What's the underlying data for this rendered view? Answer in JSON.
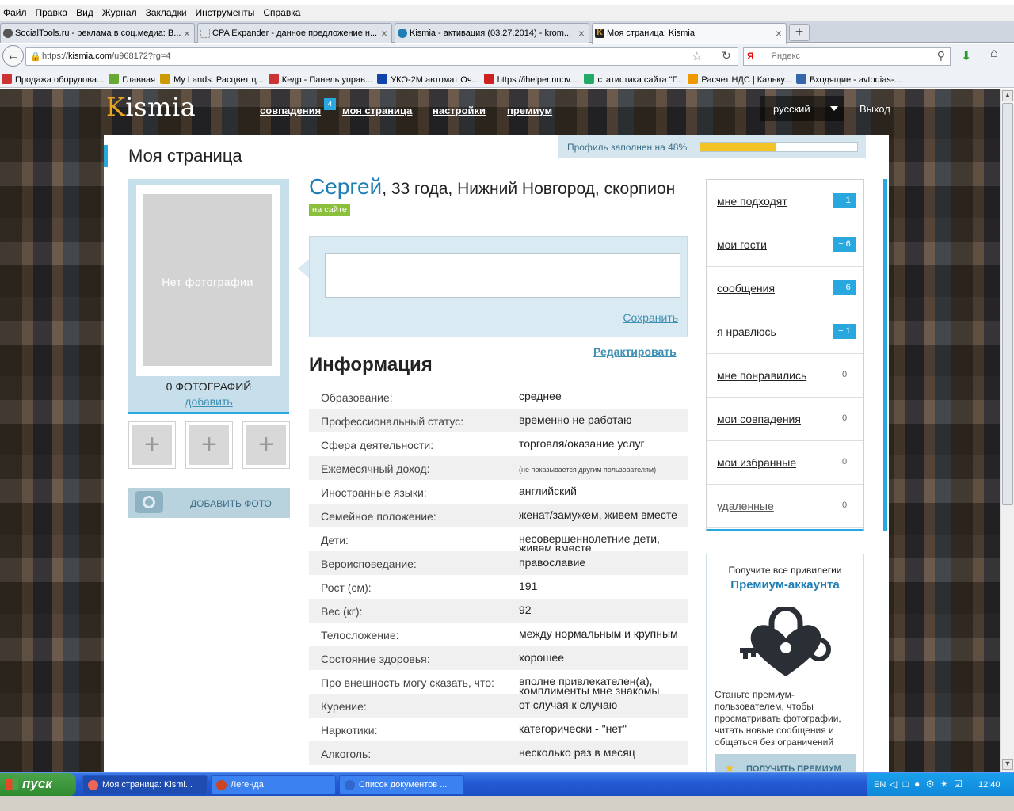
{
  "menu": [
    "Файл",
    "Правка",
    "Вид",
    "Журнал",
    "Закладки",
    "Инструменты",
    "Справка"
  ],
  "tabs": [
    {
      "label": "SocialTools.ru - реклама в соц.медиа: В...",
      "color": "#555"
    },
    {
      "label": "CPA Expander - данное предложение н...",
      "color": "#999"
    },
    {
      "label": "Kismia - активация (03.27.2014) - krom...",
      "color": "#1f7fb5"
    },
    {
      "label": "Моя страница: Kismia",
      "color": "#222"
    }
  ],
  "address": {
    "prefix": "https://",
    "host": "kismia.com",
    "path": "/u968172?rg=4"
  },
  "search": {
    "placeholder": "Яндекс"
  },
  "bookmarks": [
    {
      "label": "Продажа оборудова...",
      "color": "#c33"
    },
    {
      "label": "Главная",
      "color": "#6a3"
    },
    {
      "label": "My Lands: Расцвет ц...",
      "color": "#c90"
    },
    {
      "label": "Кедр - Панель управ...",
      "color": "#c33"
    },
    {
      "label": "УКО-2М автомат Оч...",
      "color": "#14a"
    },
    {
      "label": "https://ihelper.nnov....",
      "color": "#c22"
    },
    {
      "label": "статистика сайта \"Г...",
      "color": "#2a6"
    },
    {
      "label": "Расчет НДС | Кальку...",
      "color": "#e90"
    },
    {
      "label": "Входящие - avtodias-...",
      "color": "#36a"
    }
  ],
  "site": {
    "logo_k": "K",
    "logo_rest": "ismia",
    "nav": {
      "matches": "совпадения",
      "matches_badge": "4",
      "mypage": "моя страница",
      "settings": "настройки",
      "premium": "премиум"
    },
    "lang": "русский",
    "logout": "Выход"
  },
  "page": {
    "title": "Моя страница",
    "progress_label": "Профиль заполнен на 48%",
    "progress": 0.48,
    "no_photo": "Нет фотографии",
    "photo_count": "0 ФОТОГРАФИЙ",
    "add_link": "добавить",
    "add_photo": "ДОБАВИТЬ ФОТО",
    "name": "Сергей",
    "details": ", 33 года, Нижний Новгород, скорпион",
    "online": "на сайте",
    "save": "Сохранить",
    "edit": "Редактировать",
    "info_title": "Информация",
    "info": [
      {
        "k": "Образование:",
        "v": "среднее"
      },
      {
        "k": "Профессиональный статус:",
        "v": "временно не работаю"
      },
      {
        "k": "Сфера деятельности:",
        "v": "торговля/оказание услуг"
      },
      {
        "k": "Ежемесячный доход:",
        "v": "(не показывается другим пользователям)",
        "small": true
      },
      {
        "k": "Иностранные языки:",
        "v": "английский"
      },
      {
        "k": "Семейное положение:",
        "v": "женат/замужем, живем вместе"
      },
      {
        "k": "Дети:",
        "v": "несовершеннолетние дети, живем вместе"
      },
      {
        "k": "Вероисповедание:",
        "v": "православие"
      },
      {
        "k": "Рост (см):",
        "v": "191"
      },
      {
        "k": "Вес (кг):",
        "v": "92"
      },
      {
        "k": "Телосложение:",
        "v": "между нормальным и крупным"
      },
      {
        "k": "Состояние здоровья:",
        "v": "хорошее"
      },
      {
        "k": "Про внешность могу сказать, что:",
        "v": "вполне привлекателен(а), комплименты мне знакомы"
      },
      {
        "k": "Курение:",
        "v": "от случая к случаю"
      },
      {
        "k": "Наркотики:",
        "v": "категорически - \"нет\""
      },
      {
        "k": "Алкоголь:",
        "v": "несколько раз в месяц"
      }
    ],
    "side": [
      {
        "label": "мне подходят",
        "count": "+ 1"
      },
      {
        "label": "мои гости",
        "count": "+ 6"
      },
      {
        "label": "сообщения",
        "count": "+ 6"
      },
      {
        "label": "я нравлюсь",
        "count": "+ 1"
      },
      {
        "label": "мне понравились",
        "count": "0",
        "zero": true
      },
      {
        "label": "мои совпадения",
        "count": "0",
        "zero": true
      },
      {
        "label": "мои избранные",
        "count": "0",
        "zero": true
      },
      {
        "label": "удаленные",
        "count": "0",
        "zero": true,
        "dim": true
      }
    ],
    "premium": {
      "line1": "Получите все привилегии",
      "line2": "Премиум-аккаунта",
      "text": "Станьте премиум-пользователем, чтобы просматривать фотографии, читать новые сообщения и общаться без ограничений",
      "button": "ПОЛУЧИТЬ ПРЕМИУМ"
    }
  },
  "taskbar": {
    "start": "пуск",
    "tasks": [
      {
        "label": "Моя страница: Kismi...",
        "color": "#e65",
        "active": true
      },
      {
        "label": "Легенда",
        "color": "#c42"
      },
      {
        "label": "Список документов ...",
        "color": "#36c"
      }
    ],
    "lang": "EN",
    "time": "12:40"
  },
  "colors": {
    "accent": "#29a8e0",
    "brand_link": "#1f7fb5",
    "progress": "#f3c224",
    "online": "#8cbf3c"
  }
}
